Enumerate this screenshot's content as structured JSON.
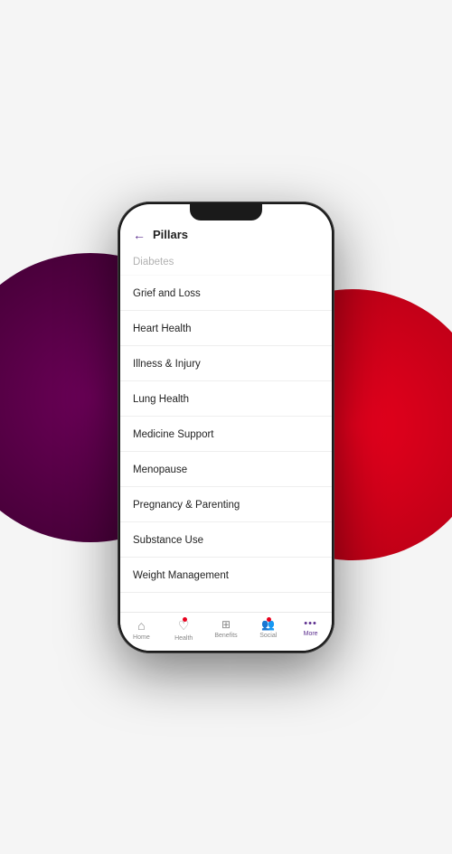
{
  "background": {
    "circle_purple": "purple circle background",
    "circle_red": "red circle background"
  },
  "header": {
    "back_label": "←",
    "title": "Pillars"
  },
  "list": {
    "items": [
      {
        "label": "Diabetes",
        "faded": true
      },
      {
        "label": "Grief and Loss",
        "faded": false
      },
      {
        "label": "Heart Health",
        "faded": false
      },
      {
        "label": "Illness & Injury",
        "faded": false
      },
      {
        "label": "Lung Health",
        "faded": false
      },
      {
        "label": "Medicine Support",
        "faded": false
      },
      {
        "label": "Menopause",
        "faded": false
      },
      {
        "label": "Pregnancy & Parenting",
        "faded": false
      },
      {
        "label": "Substance Use",
        "faded": false
      },
      {
        "label": "Weight Management",
        "faded": false
      }
    ]
  },
  "bottom_nav": {
    "items": [
      {
        "id": "home",
        "label": "Home",
        "icon": "⌂",
        "active": false,
        "has_dot": false
      },
      {
        "id": "health",
        "label": "Health",
        "icon": "♡",
        "active": false,
        "has_dot": true
      },
      {
        "id": "benefits",
        "label": "Benefits",
        "icon": "◈",
        "active": false,
        "has_dot": false
      },
      {
        "id": "social",
        "label": "Social",
        "icon": "⊕",
        "active": false,
        "has_dot": true
      },
      {
        "id": "more",
        "label": "More",
        "icon": "···",
        "active": true,
        "has_dot": false
      }
    ]
  }
}
